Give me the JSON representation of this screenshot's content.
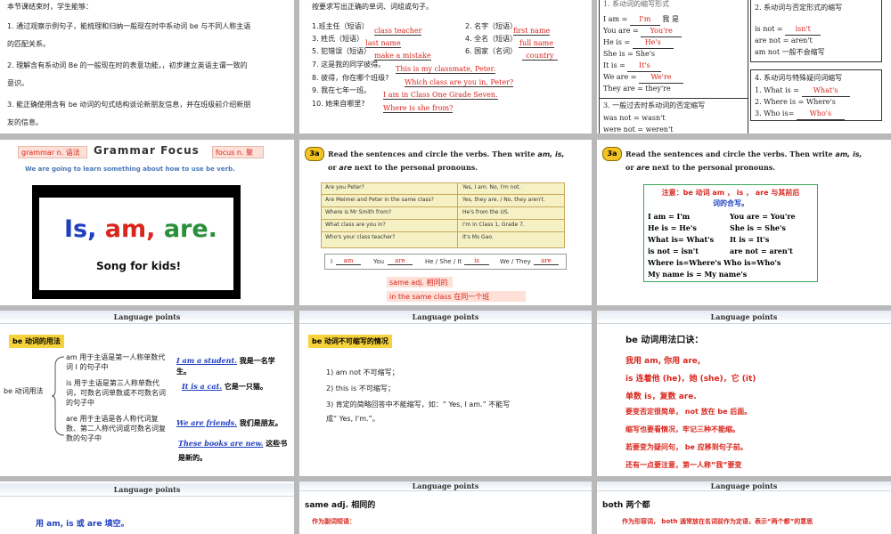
{
  "s1": {
    "intro": "本节课结束时，学生能够：",
    "o1": "1.  通过观察示例句子，能梳理和归纳一般现在时中系动词 be 与不同人称主语",
    "o1b": "的匹配关系。",
    "o2": "2.  理解含有系动词 Be 的一般现在时的表意功能，，初步建立英语主谓一致的",
    "o2b": "意识。",
    "o3": "3.  能正确使用含有 be 动词的句式结构谈论新朋友信息，并在班级前介绍新朋",
    "o3b": "友的信息。"
  },
  "s2": {
    "instr": "按要求写出正确的单词、词组或句子。",
    "i1": "1.班主任（短语）",
    "a1": "class teacher",
    "i2": "2.  名字（短语）",
    "a2": "first name",
    "i3": "3.  姓氏（短语）",
    "a3": "last name",
    "i4": "4.  全名（短语）",
    "a4": "full name",
    "i5": "5.  犯错误（短语）",
    "a5": "make a mistake",
    "i6": "6.  国家（名词）",
    "a6": "country",
    "i7": "7.  这是我的同学彼得。",
    "a7": "This is my classmate, Peter.",
    "i8": "8.  彼得，你在哪个班级?",
    "a8": "Which class are you in, Peter?",
    "i9": "9.  我在七年一班。",
    "a9": "I am in Class One Grade Seven.",
    "i10": "10.  她来自哪里?",
    "a10": "Where is she from?"
  },
  "s3": {
    "top_hint": "1. 系动词的缩写形式",
    "l1a": "I am =",
    "l1b": "I'm",
    "l1c": "我 是",
    "l2a": "You are =",
    "l2b": "You're",
    "l3a": "He is =",
    "l3b": "He's",
    "l4": "She is = She's",
    "l5a": "It is =",
    "l5b": "It's",
    "l6a": "We are =",
    "l6b": "We're",
    "l7": "They are = they're",
    "b2t": "2.  系动词与否定形式的缩写",
    "b2a": "is not =",
    "b2b": "isn't",
    "b2c": "are not = aren't",
    "b2d": "am not   一般不会缩写",
    "b3t": "3.  一般过去时系动词的否定缩写",
    "b3a": "was not = wasn't",
    "b3b": "were not = weren't",
    "b4t": "4.  系动词与特殊疑问词缩写",
    "b4a": "1. What is =",
    "b4aa": "What's",
    "b4b": "2. Where is = Where's",
    "b4c": "3. Who is=",
    "b4cc": "Who's"
  },
  "s4": {
    "tag1": "grammar n. 语法",
    "title": "Grammar Focus",
    "tag2": "focus n. 聚焦",
    "sub": "We are going to learn something about how to use be verb.",
    "v_is": "Is,",
    "v_am": "am,",
    "v_are": "are.",
    "v_song": "Song for kids!"
  },
  "s5": {
    "badge": "3a",
    "instr1": "Read the sentences and circle the verbs. Then write ",
    "instr_bold": "am, is,",
    "instr2": "or ",
    "instr_bold2": "are",
    "instr3": " next to the personal pronouns.",
    "rows": [
      [
        "Are you Peter?",
        "Yes, I am. No, I'm not."
      ],
      [
        "Are Meimei and Peter in the same class?",
        "Yes, they are. / No, they aren't."
      ],
      [
        "Where is Mr Smith from?",
        "He's from the US."
      ],
      [
        "What class are you in?",
        "I'm in Class 1, Grade 7."
      ],
      [
        "Who's your class teacher?",
        "It's Ms Gao."
      ]
    ],
    "w_i": "I",
    "w_am": "am",
    "w_you": "You",
    "w_are": "are",
    "w_he": "He / She / It",
    "w_is": "is",
    "w_we": "We / They",
    "w_are2": "are",
    "note1": "same  adj. 相同的",
    "note2": "in the same class 在同一个班"
  },
  "s6": {
    "badge": "3a",
    "instr1": "Read the sentences and circle the verbs. Then write ",
    "instr_bold": "am, is,",
    "instr2": "or ",
    "instr_bold2": "are",
    "instr3": " next to the personal pronouns.",
    "n_title": "注意：be 动词 am ， is ，  are 与其前后",
    "n_title2": "词的合写。",
    "n1a": "I am = I'm",
    "n1b": "You are = You're",
    "n2a": "He is = He's",
    "n2b": "She is = She's",
    "n3a": "What is= What's",
    "n3b": "It is = It's",
    "n4a": "is not = isn't",
    "n4b": "are not = aren't",
    "n5": "Where is=Where's Who is=Who's",
    "n6": "My name is = My name's"
  },
  "s7": {
    "header": "Language points",
    "tag": "be 动词的用法",
    "side": "be 动词用法",
    "r1": "am 用于主语是第一人称单数代词   I   的句子中",
    "r2": "is 用于主语是第三人称单数代词，可数名词单数或不可数名词的句子中",
    "r3": "are 用于主语是各人称代词复数、第二人称代词或可数名词复数的句子中",
    "e1a": "I am a student.",
    "e1b": "我是一名学生。",
    "e2a": "It is a cat.",
    "e2b": "它是一只猫。",
    "e3a": "We are friends.",
    "e3b": "我们是朋友。",
    "e4a": "These books are new.",
    "e4b": "这些书是新的。"
  },
  "s8": {
    "header": "Language points",
    "tag": "be 动词不可缩写的情况",
    "p1": "1) am not 不可缩写；",
    "p2": "2) this is 不可缩写；",
    "p3": "3)  肯定的简略回答中不能缩写，如：“ Yes, I am.” 不能写",
    "p3b": "成“ Yes, I'm.”。"
  },
  "s9": {
    "header": "Language points",
    "title": "be  动词用法口诀：",
    "l1": "我用 am, 你用 are,",
    "l2": "is  连着他 (he)，她 (she)，它 (it)",
    "l3": "单数 is，复数 are.",
    "l4": "要变否定很简单，  not 放在 be 后面。",
    "l5": "缩写也要看情况，牢记三种不能缩。",
    "l6": "若要变为疑问句，  be 应移到句子前。",
    "l7": "还有一点要注意，第一人称“我”要变"
  },
  "s10": {
    "header": "Language points",
    "text": "用 am, is 或 are 填空。"
  },
  "s11": {
    "header": "Language points",
    "title": "same adj.  相同的",
    "sub": "作为副词短语："
  },
  "s12": {
    "header": "Language points",
    "title": "both   两个都",
    "sub": "作为形容词，  both 通常放在名词前作为定语，表示“两个都”的意思"
  }
}
